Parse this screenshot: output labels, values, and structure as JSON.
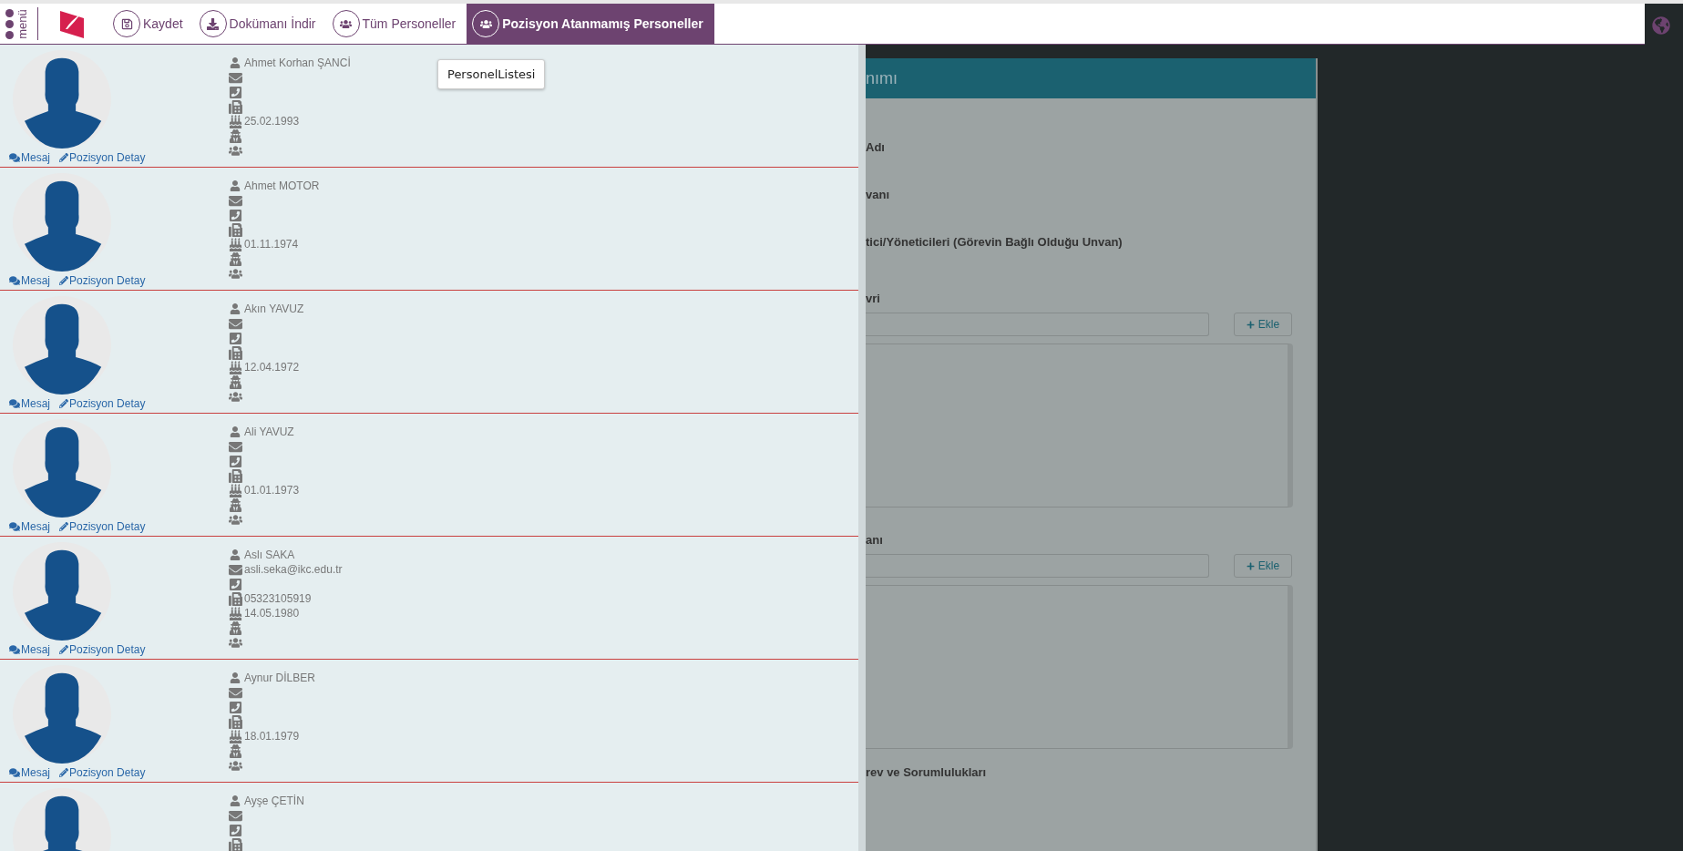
{
  "toolbar": {
    "menu_label": "menü",
    "buttons": [
      {
        "label": "Kaydet",
        "kind": "save",
        "selected": false
      },
      {
        "label": "Dokümanı İndir",
        "kind": "download",
        "selected": false
      },
      {
        "label": "Tüm Personeller",
        "kind": "people",
        "selected": false
      },
      {
        "label": "Pozisyon Atanmamış Personeller",
        "kind": "people",
        "selected": true
      }
    ]
  },
  "tooltip": "PersonelListesi",
  "people": [
    {
      "name": "Ahmet Korhan ŞANCİ",
      "birth_date": "25.02.1993",
      "actions": [
        "Mesaj",
        "Pozisyon Detay"
      ]
    },
    {
      "name": "Ahmet MOTOR",
      "birth_date": "01.11.1974",
      "actions": [
        "Mesaj",
        "Pozisyon Detay"
      ]
    },
    {
      "name": "Akın YAVUZ",
      "birth_date": "12.04.1972",
      "actions": [
        "Mesaj",
        "Pozisyon Detay"
      ]
    },
    {
      "name": "Ali YAVUZ",
      "birth_date": "01.01.1973",
      "actions": [
        "Mesaj",
        "Pozisyon Detay"
      ]
    },
    {
      "name": "Aslı SAKA",
      "email": "asli.seka@ikc.edu.tr",
      "fax": "05323105919",
      "birth_date": "14.05.1980",
      "actions": [
        "Mesaj",
        "Pozisyon Detay"
      ]
    },
    {
      "name": "Aynur DİLBER",
      "birth_date": "18.01.1979",
      "actions": [
        "Mesaj",
        "Pozisyon Detay"
      ]
    },
    {
      "name": "Ayşe ÇETİN"
    }
  ],
  "form": {
    "title": "nımı",
    "sections": [
      {
        "kind": "label",
        "text": "Adı"
      },
      {
        "kind": "label",
        "text": "vanı"
      },
      {
        "kind": "label",
        "text": "tici/Yöneticileri (Görevin Bağlı Olduğu Unvan)"
      },
      {
        "kind": "list",
        "text": "vri",
        "button": "Ekle"
      },
      {
        "kind": "list",
        "text": "anı",
        "button": "Ekle"
      },
      {
        "kind": "label",
        "text": "rev ve Sorumlulukları"
      }
    ]
  }
}
